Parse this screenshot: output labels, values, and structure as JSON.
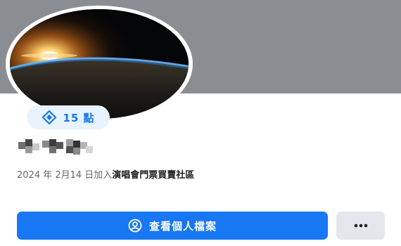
{
  "profile": {
    "points_label": "15 點",
    "join_date": "2024 年 2月14 日加入",
    "group_name": "演唱會門票買賣社區"
  },
  "actions": {
    "view_profile_label": "查看個人檔案"
  },
  "icons": {
    "points": "diamond-icon",
    "view_profile": "person-circle-icon",
    "more": "more-dots-icon"
  },
  "colors": {
    "accent": "#1877f2",
    "badge_bg": "#e7f3ff",
    "cover": "#8a8d91",
    "secondary_button": "#e4e6eb"
  }
}
